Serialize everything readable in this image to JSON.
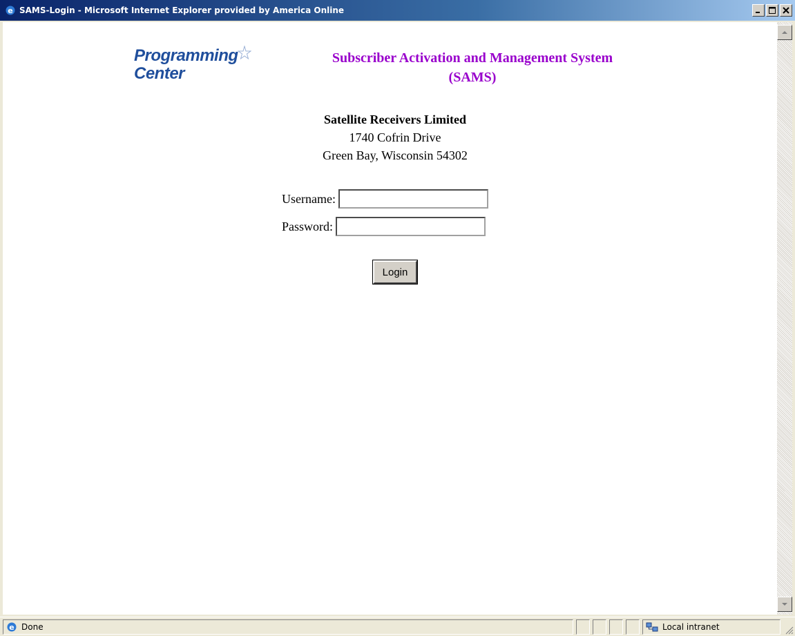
{
  "window": {
    "title": "SAMS-Login - Microsoft Internet Explorer provided by America Online",
    "buttons": [
      "minimize",
      "maximize",
      "close"
    ]
  },
  "logo": {
    "line1": "Programming",
    "line2": "Center"
  },
  "header": {
    "title_line1": "Subscriber Activation and Management System",
    "title_line2": "(SAMS)"
  },
  "company": {
    "name": "Satellite Receivers Limited",
    "address1": "1740 Cofrin Drive",
    "address2": "Green Bay, Wisconsin 54302"
  },
  "form": {
    "username_label": "Username:",
    "username_value": "",
    "password_label": "Password:",
    "password_value": "",
    "login_label": "Login"
  },
  "statusbar": {
    "status_text": "Done",
    "zone_text": "Local intranet"
  },
  "colors": {
    "header_title": "#9900cc",
    "logo": "#1f4e9c",
    "titlebar": "#0a246a"
  },
  "icons": [
    "ie-icon",
    "minimize-icon",
    "maximize-icon",
    "close-icon",
    "scroll-up-icon",
    "scroll-down-icon",
    "done-page-icon",
    "intranet-icon",
    "resize-grip-icon"
  ]
}
